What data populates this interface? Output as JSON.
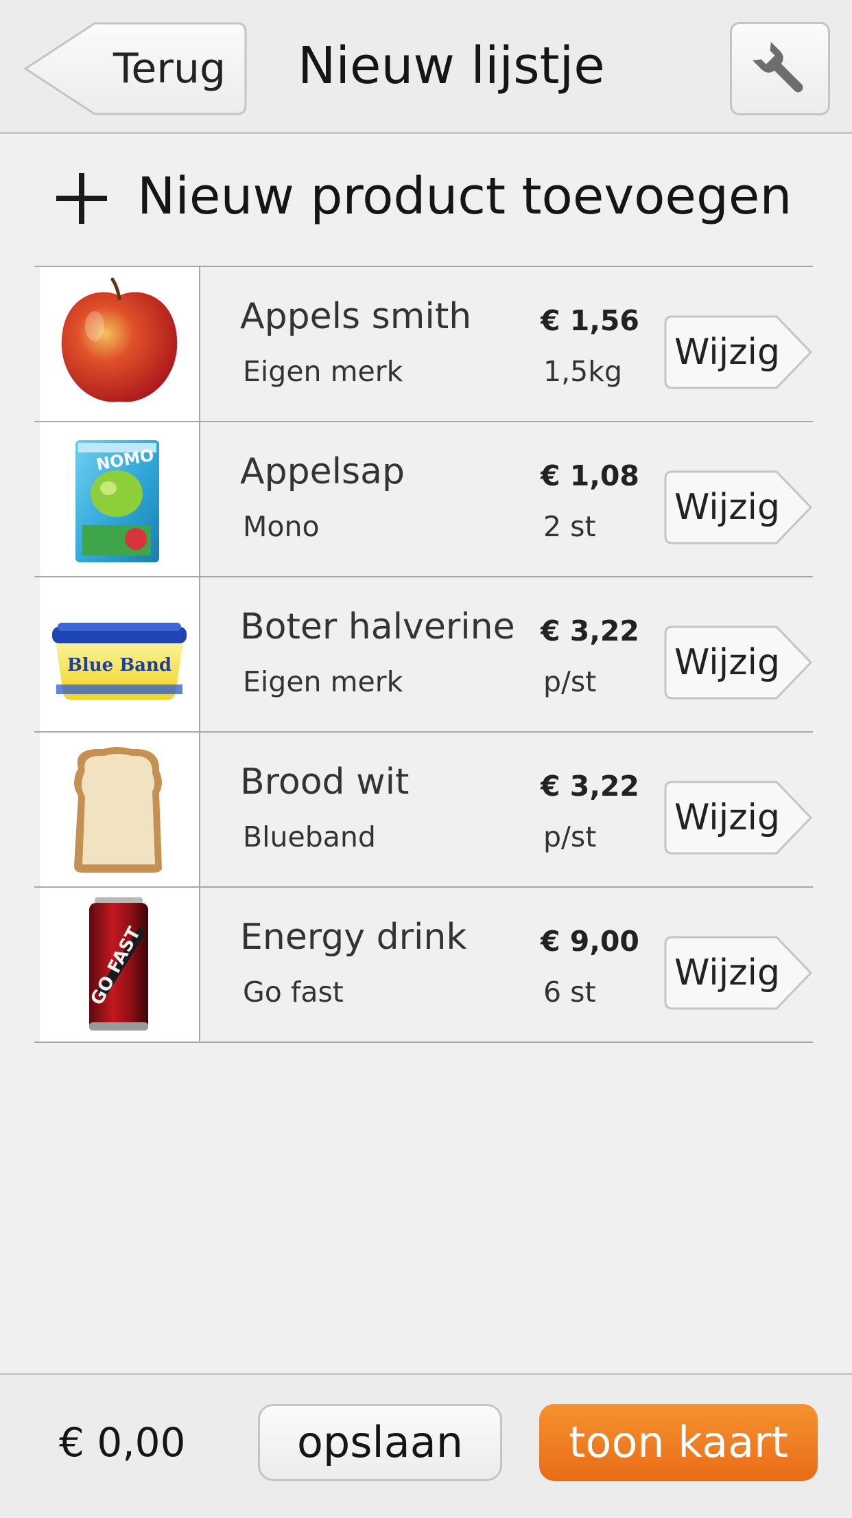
{
  "header": {
    "back_label": "Terug",
    "title": "Nieuw lijstje",
    "settings_icon": "wrench-icon"
  },
  "add_product": {
    "icon": "plus-icon",
    "label": "Nieuw product toevoegen"
  },
  "products": [
    {
      "name": "Appels smith",
      "brand": "Eigen merk",
      "price": "€ 1,56",
      "quantity": "1,5kg",
      "edit_label": "Wijzig",
      "image": "apple-image"
    },
    {
      "name": "Appelsap",
      "brand": "Mono",
      "price": "€ 1,08",
      "quantity": "2 st",
      "edit_label": "Wijzig",
      "image": "juice-carton-image"
    },
    {
      "name": "Boter halverine",
      "brand": "Eigen merk",
      "price": "€ 3,22",
      "quantity": "p/st",
      "edit_label": "Wijzig",
      "image": "margarine-tub-image"
    },
    {
      "name": "Brood wit",
      "brand": "Blueband",
      "price": "€ 3,22",
      "quantity": "p/st",
      "edit_label": "Wijzig",
      "image": "bread-slice-image"
    },
    {
      "name": "Energy drink",
      "brand": "Go fast",
      "price": "€ 9,00",
      "quantity": "6 st",
      "edit_label": "Wijzig",
      "image": "energy-can-image"
    }
  ],
  "footer": {
    "total": "€ 0,00",
    "save_label": "opslaan",
    "map_label": "toon kaart"
  },
  "colors": {
    "accent_orange": "#f08424",
    "background": "#f0f0f0",
    "divider": "#a8a8a8"
  }
}
